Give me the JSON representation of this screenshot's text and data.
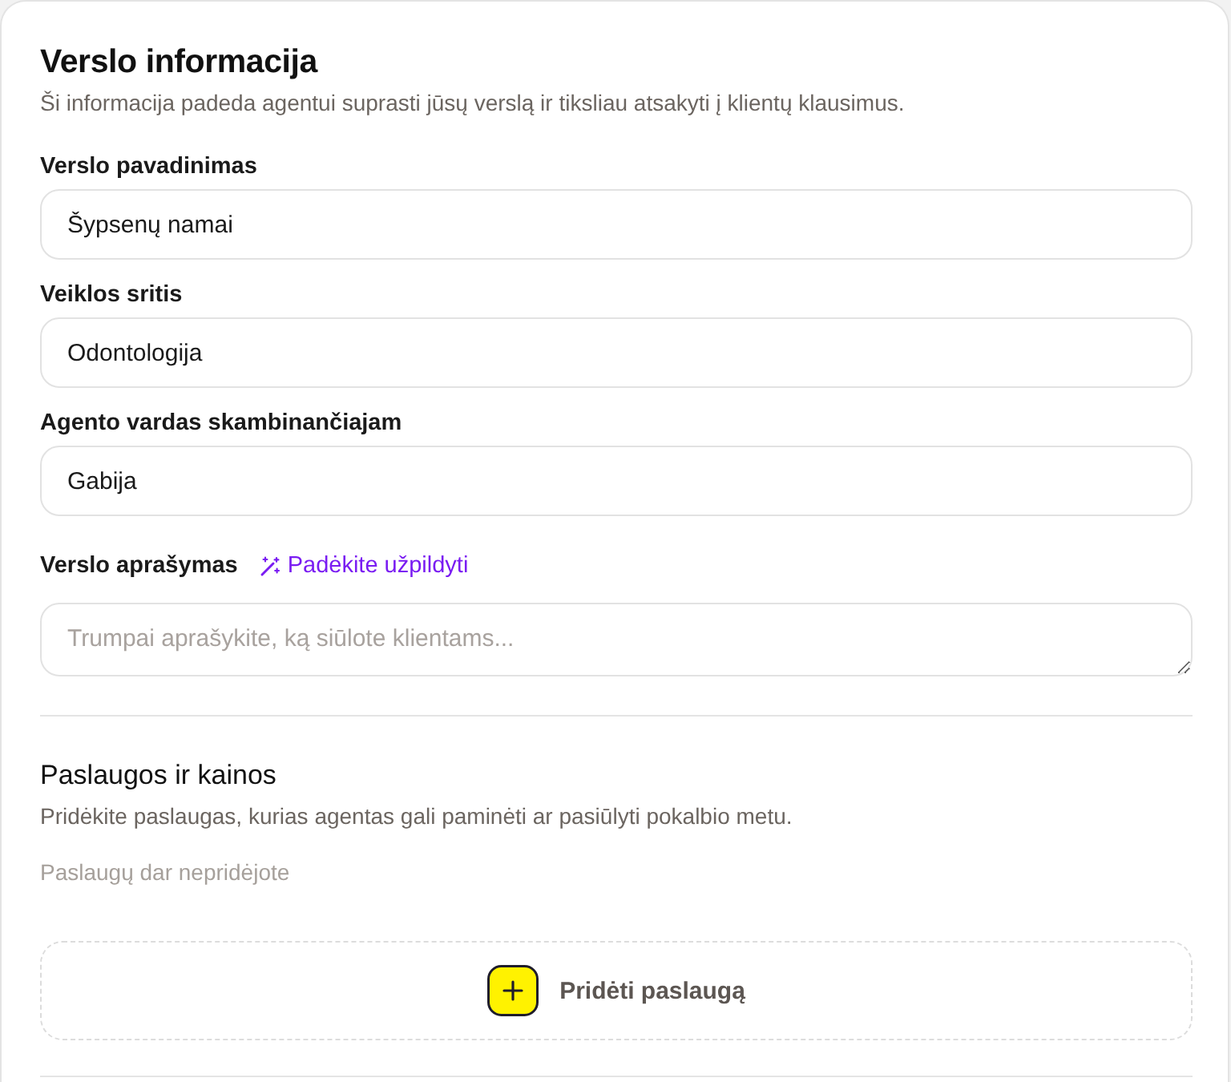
{
  "section": {
    "title": "Verslo informacija",
    "description": "Ši informacija padeda agentui suprasti jūsų verslą ir tiksliau atsakyti į klientų klausimus."
  },
  "fields": [
    {
      "kind": "input",
      "label": "Verslo pavadinimas",
      "value": "Šypsenų namai"
    },
    {
      "kind": "input",
      "label": "Veiklos sritis",
      "value": "Odontologija"
    },
    {
      "kind": "input",
      "label": "Agento vardas skambinančiajam",
      "value": "Gabija"
    },
    {
      "kind": "textarea",
      "label": "Verslo aprašymas",
      "assist_link": "Padėkite užpildyti",
      "placeholder": "Trumpai aprašykite, ką siūlote klientams..."
    }
  ],
  "services": {
    "title": "Paslaugos ir kainos",
    "description": "Pridėkite paslaugas, kurias agentas gali paminėti ar pasiūlyti pokalbio metu.",
    "empty_text": "Paslaugų dar nepridėjote",
    "add_button": "Pridėti paslaugą"
  }
}
